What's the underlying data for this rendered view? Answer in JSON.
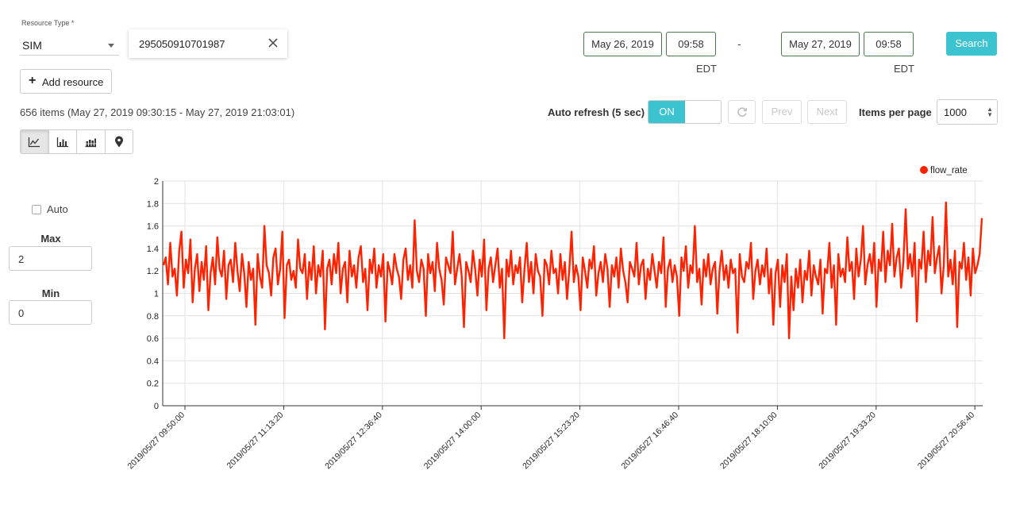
{
  "resource_type": {
    "label": "Resource Type *",
    "value": "SIM"
  },
  "resource_id": {
    "value": "295050910701987",
    "clear_icon": "close-icon"
  },
  "add_resource": {
    "label": "Add resource",
    "icon": "plus-icon"
  },
  "date_range": {
    "start_date": "May 26, 2019",
    "start_time": "09:58",
    "start_tz": "EDT",
    "separator": "-",
    "end_date": "May 27, 2019",
    "end_time": "09:58",
    "end_tz": "EDT"
  },
  "search_button": {
    "label": "Search",
    "color": "#3cc3d0"
  },
  "items_summary": "656 items (May 27, 2019 09:30:15 - May 27, 2019 21:03:01)",
  "auto_refresh": {
    "label": "Auto refresh (5 sec)",
    "state": "ON"
  },
  "pager": {
    "refresh_icon": "refresh-icon",
    "prev": "Prev",
    "next": "Next"
  },
  "items_per_page": {
    "label": "Items per page",
    "value": "1000"
  },
  "view_buttons": [
    {
      "name": "line-chart-icon",
      "active": true
    },
    {
      "name": "bar-chart-icon",
      "active": false
    },
    {
      "name": "stacked-bar-chart-icon",
      "active": false
    },
    {
      "name": "map-marker-icon",
      "active": false
    }
  ],
  "scale": {
    "auto_label": "Auto",
    "auto_checked": false,
    "max_label": "Max",
    "max_value": "2",
    "min_label": "Min",
    "min_value": "0"
  },
  "chart_data": {
    "type": "line",
    "title": "",
    "xlabel": "",
    "ylabel": "",
    "ylim": [
      0,
      2
    ],
    "yticks": [
      "0",
      "0.2",
      "0.4",
      "0.6",
      "0.8",
      "1",
      "1.2",
      "1.4",
      "1.6",
      "1.8",
      "2"
    ],
    "xticks": [
      "2019/05/27 09:50:00",
      "2019/05/27 11:13:20",
      "2019/05/27 12:36:40",
      "2019/05/27 14:00:00",
      "2019/05/27 15:23:20",
      "2019/05/27 16:46:40",
      "2019/05/27 18:10:00",
      "2019/05/27 19:33:20",
      "2019/05/27 20:56:40"
    ],
    "legend_position": "top-right",
    "grid": true,
    "series": [
      {
        "name": "flow_rate",
        "color": "#ff2200",
        "values": [
          1.25,
          1.32,
          1.08,
          1.45,
          1.15,
          1.22,
          0.98,
          1.38,
          1.55,
          1.05,
          1.3,
          1.18,
          1.48,
          0.92,
          1.22,
          1.35,
          1.02,
          1.28,
          1.12,
          1.42,
          0.85,
          1.18,
          1.32,
          1.08,
          1.5,
          1.22,
          1.15,
          1.38,
          0.95,
          1.25,
          1.3,
          1.1,
          1.45,
          1.2,
          1.02,
          1.35,
          1.18,
          0.88,
          1.28,
          1.12,
          1.22,
          0.72,
          1.35,
          1.15,
          1.05,
          1.6,
          1.25,
          1.18,
          0.98,
          1.32,
          1.4,
          1.08,
          1.22,
          1.55,
          0.78,
          1.25,
          1.3,
          1.12,
          1.2,
          1.05,
          1.48,
          1.22,
          1.18,
          1.35,
          0.95,
          1.28,
          1.12,
          1.42,
          1.0,
          1.25,
          1.15,
          1.38,
          0.68,
          1.22,
          1.3,
          1.08,
          1.35,
          1.18,
          1.45,
          1.0,
          1.22,
          1.28,
          0.92,
          1.38,
          1.15,
          1.25,
          1.05,
          1.32,
          1.42,
          1.1,
          1.22,
          0.85,
          1.3,
          1.18,
          1.4,
          1.05,
          1.25,
          1.15,
          1.35,
          0.75,
          1.28,
          1.2,
          1.08,
          1.35,
          1.22,
          1.15,
          0.95,
          1.3,
          1.4,
          1.12,
          1.25,
          1.05,
          1.65,
          1.2,
          1.1,
          1.3,
          1.22,
          0.8,
          1.35,
          1.18,
          1.28,
          1.02,
          1.45,
          1.22,
          1.12,
          0.9,
          1.32,
          1.25,
          1.18,
          1.55,
          1.08,
          1.22,
          1.35,
          1.15,
          0.7,
          1.28,
          1.2,
          1.1,
          1.38,
          1.22,
          0.98,
          1.3,
          1.15,
          1.48,
          0.85,
          1.22,
          1.32,
          1.1,
          1.25,
          1.4,
          1.05,
          1.22,
          0.6,
          1.3,
          1.15,
          1.38,
          1.08,
          1.25,
          1.18,
          1.32,
          0.92,
          1.22,
          1.45,
          1.1,
          1.28,
          1.0,
          1.35,
          1.2,
          1.15,
          0.8,
          1.3,
          1.25,
          1.08,
          1.38,
          1.18,
          1.22,
          1.0,
          1.35,
          1.12,
          1.28,
          0.95,
          1.22,
          1.55,
          1.1,
          1.25,
          1.15,
          0.85,
          1.32,
          1.2,
          1.05,
          1.3,
          1.22,
          1.42,
          0.98,
          1.18,
          1.28,
          1.1,
          1.35,
          1.22,
          0.88,
          1.25,
          1.15,
          1.32,
          1.05,
          1.4,
          1.2,
          1.1,
          0.92,
          1.28,
          1.22,
          1.15,
          1.45,
          1.08,
          1.25,
          1.3,
          0.95,
          1.22,
          1.12,
          1.35,
          1.2,
          1.05,
          1.28,
          1.18,
          1.5,
          0.88,
          1.22,
          1.3,
          1.1,
          1.25,
          1.15,
          0.8,
          1.32,
          1.2,
          1.42,
          1.05,
          1.25,
          1.18,
          1.6,
          1.1,
          1.22,
          0.9,
          1.3,
          1.15,
          1.35,
          1.08,
          1.22,
          1.28,
          0.82,
          1.2,
          1.38,
          1.12,
          1.25,
          1.05,
          1.3,
          1.18,
          1.22,
          0.65,
          1.35,
          1.15,
          1.1,
          1.28,
          1.22,
          1.45,
          0.95,
          1.2,
          1.3,
          1.08,
          1.25,
          1.15,
          1.4,
          1.0,
          1.22,
          0.72,
          1.18,
          1.3,
          0.88,
          1.25,
          1.1,
          1.35,
          0.6,
          1.15,
          0.85,
          1.22,
          1.05,
          1.3,
          0.92,
          1.2,
          1.12,
          1.38,
          0.98,
          1.25,
          1.15,
          1.08,
          1.3,
          0.82,
          1.22,
          1.18,
          1.45,
          1.05,
          1.25,
          0.72,
          1.35,
          1.15,
          1.22,
          1.1,
          1.5,
          1.2,
          1.28,
          0.95,
          1.4,
          1.15,
          1.3,
          1.6,
          1.08,
          1.25,
          1.35,
          1.18,
          1.45,
          0.88,
          1.3,
          1.2,
          1.55,
          1.1,
          1.38,
          1.25,
          1.62,
          1.15,
          1.32,
          1.4,
          1.05,
          1.28,
          1.75,
          1.22,
          1.35,
          1.15,
          1.45,
          0.75,
          1.3,
          1.22,
          1.55,
          1.1,
          1.38,
          1.25,
          1.68,
          1.18,
          1.32,
          1.42,
          1.0,
          1.25,
          1.81,
          1.15,
          1.3,
          1.08,
          1.38,
          0.7,
          1.28,
          1.22,
          1.45,
          1.12,
          1.32,
          0.98,
          1.4,
          1.18,
          1.25,
          1.35,
          1.67
        ]
      }
    ]
  }
}
